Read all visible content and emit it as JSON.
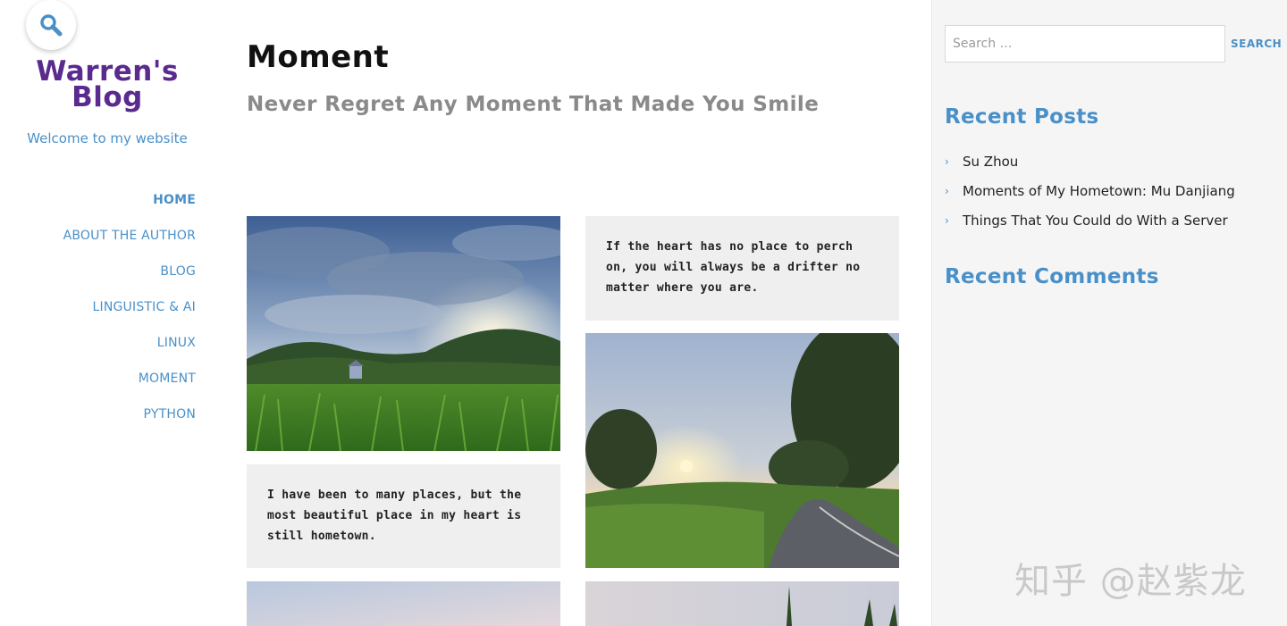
{
  "site": {
    "title_line1": "Warren's",
    "title_line2": "Blog",
    "tagline": "Welcome to my website",
    "brand_color": "#5a2a8e",
    "accent_color": "#4a90c8"
  },
  "nav": {
    "items": [
      {
        "label": "HOME",
        "active": true
      },
      {
        "label": "ABOUT THE AUTHOR"
      },
      {
        "label": "BLOG"
      },
      {
        "label": "LINGUISTIC & AI"
      },
      {
        "label": "LINUX"
      },
      {
        "label": "MOMENT"
      },
      {
        "label": "PYTHON"
      }
    ]
  },
  "main": {
    "title": "Moment",
    "subtitle": "Never Regret Any Moment That Made You Smile",
    "quotes": [
      "If the heart has no place to perch on, you will always be a drifter no matter where you are.",
      "I have been to many places, but the most beautiful place in my heart is still hometown."
    ],
    "photos": [
      "landscape-photo-cornfield",
      "landscape-photo-sunset-road",
      "landscape-photo-sky",
      "landscape-photo-plants"
    ]
  },
  "sidebar": {
    "search": {
      "placeholder": "Search …",
      "button": "SEARCH"
    },
    "recent_posts_title": "Recent Posts",
    "recent_posts": [
      "Su Zhou",
      "Moments of My Hometown: Mu Danjiang",
      "Things That You Could do With a Server"
    ],
    "recent_comments_title": "Recent Comments",
    "watermark": "知乎 @赵紫龙"
  }
}
